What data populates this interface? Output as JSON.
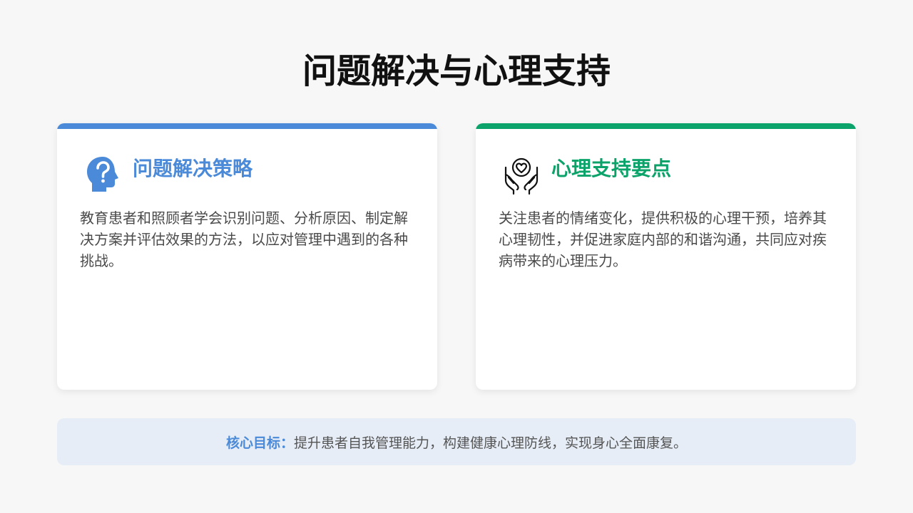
{
  "page": {
    "title": "问题解决与心理支持"
  },
  "cards": [
    {
      "title": "问题解决策略",
      "icon": "head-question-icon",
      "accent": "#4a8ad8",
      "text": "教育患者和照顾者学会识别问题、分析原因、制定解决方案并评估效果的方法，以应对管理中遇到的各种挑战。"
    },
    {
      "title": "心理支持要点",
      "icon": "hands-heart-icon",
      "accent": "#0ca36a",
      "text": "关注患者的情绪变化，提供积极的心理干预，培养其心理韧性，并促进家庭内部的和谐沟通，共同应对疾病带来的心理压力。"
    }
  ],
  "goal": {
    "label": "核心目标：",
    "text": "提升患者自我管理能力，构建健康心理防线，实现身心全面康复。"
  }
}
